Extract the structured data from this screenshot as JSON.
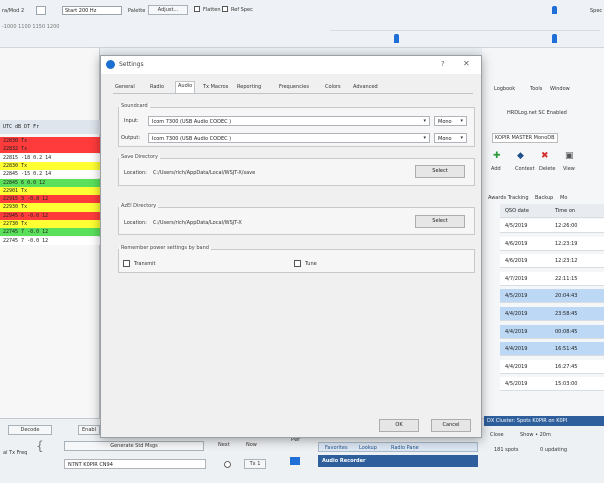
{
  "toolbar": {
    "mode_label": "ra/Mod 2",
    "start_label": "Start 200 Hz",
    "palette_label": "Palette",
    "adjust_label": "Adjust...",
    "flatten_label": "Flatten",
    "ref_spec_label": "Ref Spec",
    "spec_label": "Spec",
    "freq_line": "-1000  1100  1150  1200"
  },
  "left_panel": {
    "header": "UTC   dB   DT Fr",
    "rows": [
      {
        "text": "22830  Tx",
        "color": "#ff3b3b"
      },
      {
        "text": "22832  Tx",
        "color": "#ff3b3b"
      },
      {
        "text": "22815 -18  0.2 14",
        "color": "#ffffff"
      },
      {
        "text": "22830  Tx",
        "color": "#ffff33"
      },
      {
        "text": "22845 -15  0.2 14",
        "color": "#ffffff"
      },
      {
        "text": "22845   6  0.0 12",
        "color": "#5be05b"
      },
      {
        "text": "22901  Tx",
        "color": "#ffff33"
      },
      {
        "text": "22915   3 -0.8 12",
        "color": "#ff3b3b"
      },
      {
        "text": "22930  Tx",
        "color": "#ffff33"
      },
      {
        "text": "22945   6 -0.0 12",
        "color": "#ff3b3b"
      },
      {
        "text": "22730  Tx",
        "color": "#ffff33"
      },
      {
        "text": "22745   7 -0.0 12",
        "color": "#5be05b"
      },
      {
        "text": "22745   7 -0.0 12",
        "color": "#ffffff"
      }
    ]
  },
  "right_panel": {
    "menu": [
      "Logbook",
      "Tools",
      "Window"
    ],
    "hrdlog_label": "HRDLog.net  SC Enabled",
    "tab_label": "KOPIR MASTER MonoDB",
    "icons": [
      {
        "name": "add-icon",
        "label": "Add"
      },
      {
        "name": "context-icon",
        "label": "Context"
      },
      {
        "name": "delete-icon",
        "label": "Delete"
      },
      {
        "name": "view-icon",
        "label": "View"
      }
    ],
    "second_row": [
      "Awards Tracking",
      "Backup",
      "Mo"
    ],
    "grid_headers": [
      "QSO date",
      "Time on"
    ],
    "grid_rows": [
      {
        "date": "4/5/2019",
        "time": "12:26:00",
        "selected": false
      },
      {
        "date": "4/6/2019",
        "time": "12:23:19",
        "selected": false
      },
      {
        "date": "4/6/2019",
        "time": "12:23:12",
        "selected": false
      },
      {
        "date": "4/7/2019",
        "time": "22:11:15",
        "selected": false
      },
      {
        "date": "4/5/2019",
        "time": "20:04:43",
        "selected": true
      },
      {
        "date": "4/4/2019",
        "time": "23:58:45",
        "selected": true
      },
      {
        "date": "4/4/2019",
        "time": "00:08:45",
        "selected": true
      },
      {
        "date": "4/4/2019",
        "time": "16:51:45",
        "selected": true
      },
      {
        "date": "4/4/2019",
        "time": "16:27:45",
        "selected": false
      },
      {
        "date": "4/5/2019",
        "time": "15:03:00",
        "selected": false
      }
    ]
  },
  "bottom": {
    "decode_label": "Decode",
    "enable_label": "Enabl",
    "txfreq_label": "al Tx Freq",
    "generate_label": "Generate Std Msgs",
    "next_label": "Next",
    "now_label": "Now",
    "pwr_label": "Pwr",
    "tx1_label": "Tx 1",
    "msg1_value": "N7NT K0PIR CN94",
    "favorites_tabs": [
      "Favorites",
      "Lookup",
      "Radio Pane"
    ],
    "audio_recorder_label": "Audio Recorder",
    "dx_cluster_label": "DX Cluster: Spots K0PIR on K0PI",
    "close_label": "Close",
    "show_label": "Show • 20m",
    "spots_label": "181 spots",
    "updating_label": "0 updating"
  },
  "dialog": {
    "title": "Settings",
    "help_glyph": "?",
    "close_glyph": "✕",
    "tabs": [
      "General",
      "Radio",
      "Audio",
      "Tx Macros",
      "Reporting",
      "Frequencies",
      "Colors",
      "Advanced"
    ],
    "active_tab": "Audio",
    "soundcard": {
      "group_label": "Soundcard",
      "input_label": "Input:",
      "input_value": "Icom 7300 (USB Audio CODEC )",
      "input_channel": "Mono",
      "output_label": "Output:",
      "output_value": "Icom 7300 (USB Audio CODEC )",
      "output_channel": "Mono"
    },
    "save_directory": {
      "group_label": "Save Directory",
      "location_label": "Location:",
      "path": "C:/Users/rich/AppData/Local/WSJT-X/save",
      "select_label": "Select"
    },
    "azel_directory": {
      "group_label": "AzEl Directory",
      "location_label": "Location:",
      "path": "C:/Users/rich/AppData/Local/WSJT-X",
      "select_label": "Select"
    },
    "remember": {
      "group_label": "Remember power settings by band",
      "transmit_label": "Transmit",
      "tune_label": "Tune"
    },
    "ok_label": "OK",
    "cancel_label": "Cancel"
  }
}
